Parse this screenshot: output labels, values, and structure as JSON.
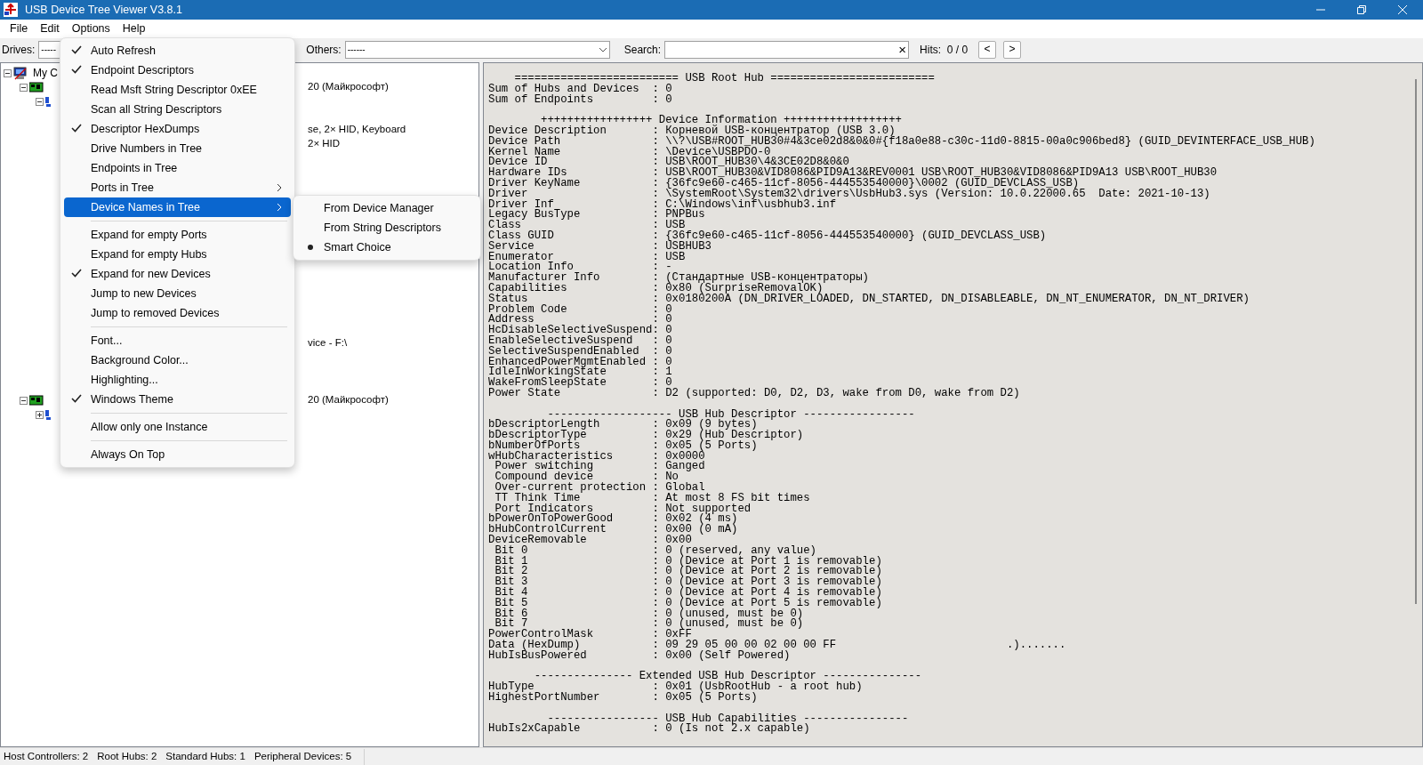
{
  "window": {
    "title": "USB Device Tree Viewer V3.8.1"
  },
  "menu_bar": [
    {
      "label": "File"
    },
    {
      "label": "Edit"
    },
    {
      "label": "Options"
    },
    {
      "label": "Help"
    }
  ],
  "toolbar": {
    "drives_label": "Drives:",
    "drives_value": "-----",
    "others_label": "Others:",
    "others_value": "------",
    "search_label": "Search:",
    "clear": "×",
    "hits": "Hits:  0 / 0",
    "prev": "<",
    "next": ">"
  },
  "tree": [
    {
      "kind": "computer",
      "text": "My C",
      "expanded": true,
      "children": [
        {
          "kind": "controller",
          "text": "20 (Майкрософт)",
          "expanded": true,
          "children": [
            {
              "kind": "hub",
              "expanded": true,
              "children": [
                {
                  "kind": "device",
                  "text": "se, 2× HID, Keyboard"
                },
                {
                  "kind": "device",
                  "text": "2× HID"
                },
                {
                  "kind": "device",
                  "text": "vice - F:\\"
                }
              ]
            }
          ]
        },
        {
          "kind": "controller",
          "text": "20 (Майкрософт)",
          "expanded": true,
          "children": [
            {
              "kind": "hub",
              "expanded": false
            }
          ]
        }
      ]
    }
  ],
  "details": [
    {
      "heading": "    ========================= USB Root Hub =========================",
      "lines": [
        "Sum of Hubs and Devices  : 0",
        "Sum of Endpoints         : 0"
      ]
    },
    {
      "heading": "        +++++++++++++++++ Device Information ++++++++++++++++++",
      "lines": [
        "Device Description       : Корневой USB-концентратор (USB 3.0)",
        "Device Path              : \\\\?\\USB#ROOT_HUB30#4&3ce02d8&0&0#{f18a0e88-c30c-11d0-8815-00a0c906bed8} (GUID_DEVINTERFACE_USB_HUB)",
        "Kernel Name              : \\Device\\USBPDO-0",
        "Device ID                : USB\\ROOT_HUB30\\4&3CE02D8&0&0",
        "Hardware IDs             : USB\\ROOT_HUB30&VID8086&PID9A13&REV0001 USB\\ROOT_HUB30&VID8086&PID9A13 USB\\ROOT_HUB30",
        "Driver KeyName           : {36fc9e60-c465-11cf-8056-444553540000}\\0002 (GUID_DEVCLASS_USB)",
        "Driver                   : \\SystemRoot\\System32\\drivers\\UsbHub3.sys (Version: 10.0.22000.65  Date: 2021-10-13)",
        "Driver Inf               : C:\\Windows\\inf\\usbhub3.inf",
        "Legacy BusType           : PNPBus",
        "Class                    : USB",
        "Class GUID               : {36fc9e60-c465-11cf-8056-444553540000} (GUID_DEVCLASS_USB)",
        "Service                  : USBHUB3",
        "Enumerator               : USB",
        "Location Info            : -",
        "Manufacturer Info        : (Стандартные USB-концентраторы)",
        "Capabilities             : 0x80 (SurpriseRemovalOK)",
        "Status                   : 0x0180200A (DN_DRIVER_LOADED, DN_STARTED, DN_DISABLEABLE, DN_NT_ENUMERATOR, DN_NT_DRIVER)",
        "Problem Code             : 0",
        "Address                  : 0",
        "HcDisableSelectiveSuspend: 0",
        "EnableSelectiveSuspend   : 0",
        "SelectiveSuspendEnabled  : 0",
        "EnhancedPowerMgmtEnabled : 0",
        "IdleInWorkingState       : 1",
        "WakeFromSleepState       : 0",
        "Power State              : D2 (supported: D0, D2, D3, wake from D0, wake from D2)"
      ]
    },
    {
      "heading": "         ------------------- USB Hub Descriptor -----------------",
      "lines": [
        "bDescriptorLength        : 0x09 (9 bytes)",
        "bDescriptorType          : 0x29 (Hub Descriptor)",
        "bNumberOfPorts           : 0x05 (5 Ports)",
        "wHubCharacteristics      : 0x0000",
        " Power switching         : Ganged",
        " Compound device         : No",
        " Over-current protection : Global",
        " TT Think Time           : At most 8 FS bit times",
        " Port Indicators         : Not supported",
        "bPowerOnToPowerGood      : 0x02 (4 ms)",
        "bHubControlCurrent       : 0x00 (0 mA)",
        "DeviceRemovable          : 0x00",
        " Bit 0                   : 0 (reserved, any value)",
        " Bit 1                   : 0 (Device at Port 1 is removable)",
        " Bit 2                   : 0 (Device at Port 2 is removable)",
        " Bit 3                   : 0 (Device at Port 3 is removable)",
        " Bit 4                   : 0 (Device at Port 4 is removable)",
        " Bit 5                   : 0 (Device at Port 5 is removable)",
        " Bit 6                   : 0 (unused, must be 0)",
        " Bit 7                   : 0 (unused, must be 0)",
        "PowerControlMask         : 0xFF",
        "Data (HexDump)           : 09 29 05 00 00 02 00 00 FF                          .).......",
        "HubIsBusPowered          : 0x00 (Self Powered)"
      ]
    },
    {
      "heading": "       --------------- Extended USB Hub Descriptor ---------------",
      "lines": [
        "HubType                  : 0x01 (UsbRootHub - a root hub)",
        "HighestPortNumber        : 0x05 (5 Ports)"
      ]
    },
    {
      "heading": "         ----------------- USB Hub Capabilities ----------------",
      "lines": [
        "HubIs2xCapable           : 0 (Is not 2.x capable)"
      ]
    }
  ],
  "options_menu": [
    {
      "kind": "item",
      "label": "Auto Refresh",
      "checked": true,
      "highlighted": false,
      "submenu": false
    },
    {
      "kind": "item",
      "label": "Endpoint Descriptors",
      "checked": true,
      "highlighted": false,
      "submenu": false
    },
    {
      "kind": "item",
      "label": "Read Msft String Descriptor 0xEE",
      "checked": false,
      "highlighted": false,
      "submenu": false
    },
    {
      "kind": "item",
      "label": "Scan all String Descriptors",
      "checked": false,
      "highlighted": false,
      "submenu": false
    },
    {
      "kind": "item",
      "label": "Descriptor HexDumps",
      "checked": true,
      "highlighted": false,
      "submenu": false
    },
    {
      "kind": "item",
      "label": "Drive Numbers in Tree",
      "checked": false,
      "highlighted": false,
      "submenu": false
    },
    {
      "kind": "item",
      "label": "Endpoints in Tree",
      "checked": false,
      "highlighted": false,
      "submenu": false
    },
    {
      "kind": "item",
      "label": "Ports in Tree",
      "checked": false,
      "highlighted": false,
      "submenu": true
    },
    {
      "kind": "item",
      "label": "Device Names in Tree",
      "checked": false,
      "highlighted": true,
      "submenu": true
    },
    {
      "kind": "separator"
    },
    {
      "kind": "item",
      "label": "Expand for empty Ports",
      "checked": false,
      "highlighted": false,
      "submenu": false
    },
    {
      "kind": "item",
      "label": "Expand for empty Hubs",
      "checked": false,
      "highlighted": false,
      "submenu": false
    },
    {
      "kind": "item",
      "label": "Expand for new Devices",
      "checked": true,
      "highlighted": false,
      "submenu": false
    },
    {
      "kind": "item",
      "label": "Jump to new Devices",
      "checked": false,
      "highlighted": false,
      "submenu": false
    },
    {
      "kind": "item",
      "label": "Jump to removed Devices",
      "checked": false,
      "highlighted": false,
      "submenu": false
    },
    {
      "kind": "separator"
    },
    {
      "kind": "item",
      "label": "Font...",
      "checked": false,
      "highlighted": false,
      "submenu": false
    },
    {
      "kind": "item",
      "label": "Background Color...",
      "checked": false,
      "highlighted": false,
      "submenu": false
    },
    {
      "kind": "item",
      "label": "Highlighting...",
      "checked": false,
      "highlighted": false,
      "submenu": false
    },
    {
      "kind": "item",
      "label": "Windows Theme",
      "checked": true,
      "highlighted": false,
      "submenu": false
    },
    {
      "kind": "separator"
    },
    {
      "kind": "item",
      "label": "Allow only one Instance",
      "checked": false,
      "highlighted": false,
      "submenu": false
    },
    {
      "kind": "separator"
    },
    {
      "kind": "item",
      "label": "Always On Top",
      "checked": false,
      "highlighted": false,
      "submenu": false
    }
  ],
  "device_names_submenu": [
    {
      "label": "From Device Manager",
      "selected": false
    },
    {
      "label": "From String Descriptors",
      "selected": false
    },
    {
      "label": "Smart Choice",
      "selected": true
    }
  ],
  "status_bar": [
    "Host Controllers: 2",
    "Root Hubs: 2",
    "Standard Hubs: 1",
    "Peripheral Devices: 5"
  ]
}
